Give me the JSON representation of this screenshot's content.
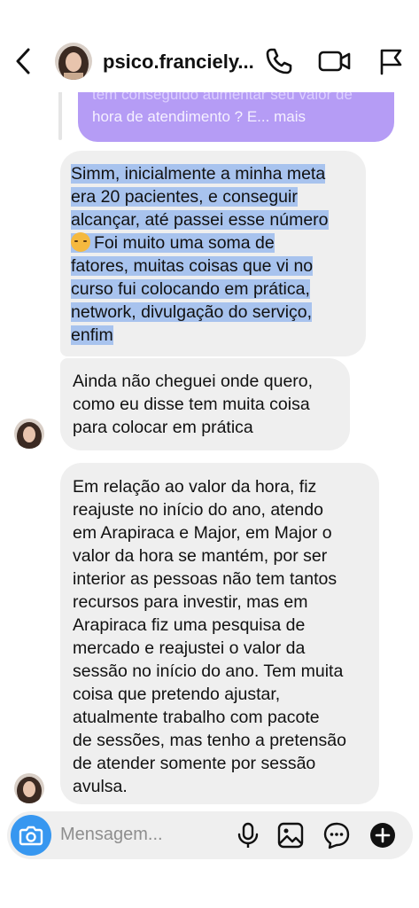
{
  "header": {
    "username": "psico.franciely..."
  },
  "quoted_message": {
    "text_top": "tem conseguido aumentar seu valor de",
    "text_bottom": "hora de atendimento ? E... mais"
  },
  "messages": [
    {
      "lines": [
        "Simm, inicialmente a minha meta",
        "era 20 pacientes, e conseguir",
        "alcançar, até passei esse número",
        "Foi muito uma soma de",
        "fatores, muitas coisas que vi no",
        "curso fui colocando em prática,",
        "network, divulgação do serviço,",
        "enfim"
      ],
      "emoji": "smiling-face-with-hearts"
    },
    {
      "lines": [
        "Ainda não cheguei onde quero,",
        "como eu disse tem muita coisa",
        "para colocar em prática"
      ]
    },
    {
      "lines": [
        "Em relação ao valor da hora, fiz",
        "reajuste no início do ano, atendo",
        "em Arapiraca e Major, em Major o",
        "valor da hora se mantém, por ser",
        "interior as pessoas não tem tantos",
        "recursos para investir, mas em",
        "Arapiraca fiz uma pesquisa de",
        "mercado e reajustei o valor da",
        "sessão no início do ano. Tem muita",
        "coisa que pretendo ajustar,",
        "atualmente trabalho com pacote",
        "de sessões, mas tenho a pretensão",
        "de atender somente por sessão",
        "avulsa."
      ]
    }
  ],
  "composer": {
    "placeholder": "Mensagem..."
  },
  "colors": {
    "accent": "#3797f0",
    "quoted_bubble": "#b59cf5",
    "received_bubble": "#efefef",
    "selection_highlight": "#a8c3ee"
  },
  "icons": [
    "back-arrow-icon",
    "phone-icon",
    "video-camera-icon",
    "flag-icon",
    "camera-icon",
    "microphone-icon",
    "image-icon",
    "sticker-icon",
    "plus-icon"
  ]
}
